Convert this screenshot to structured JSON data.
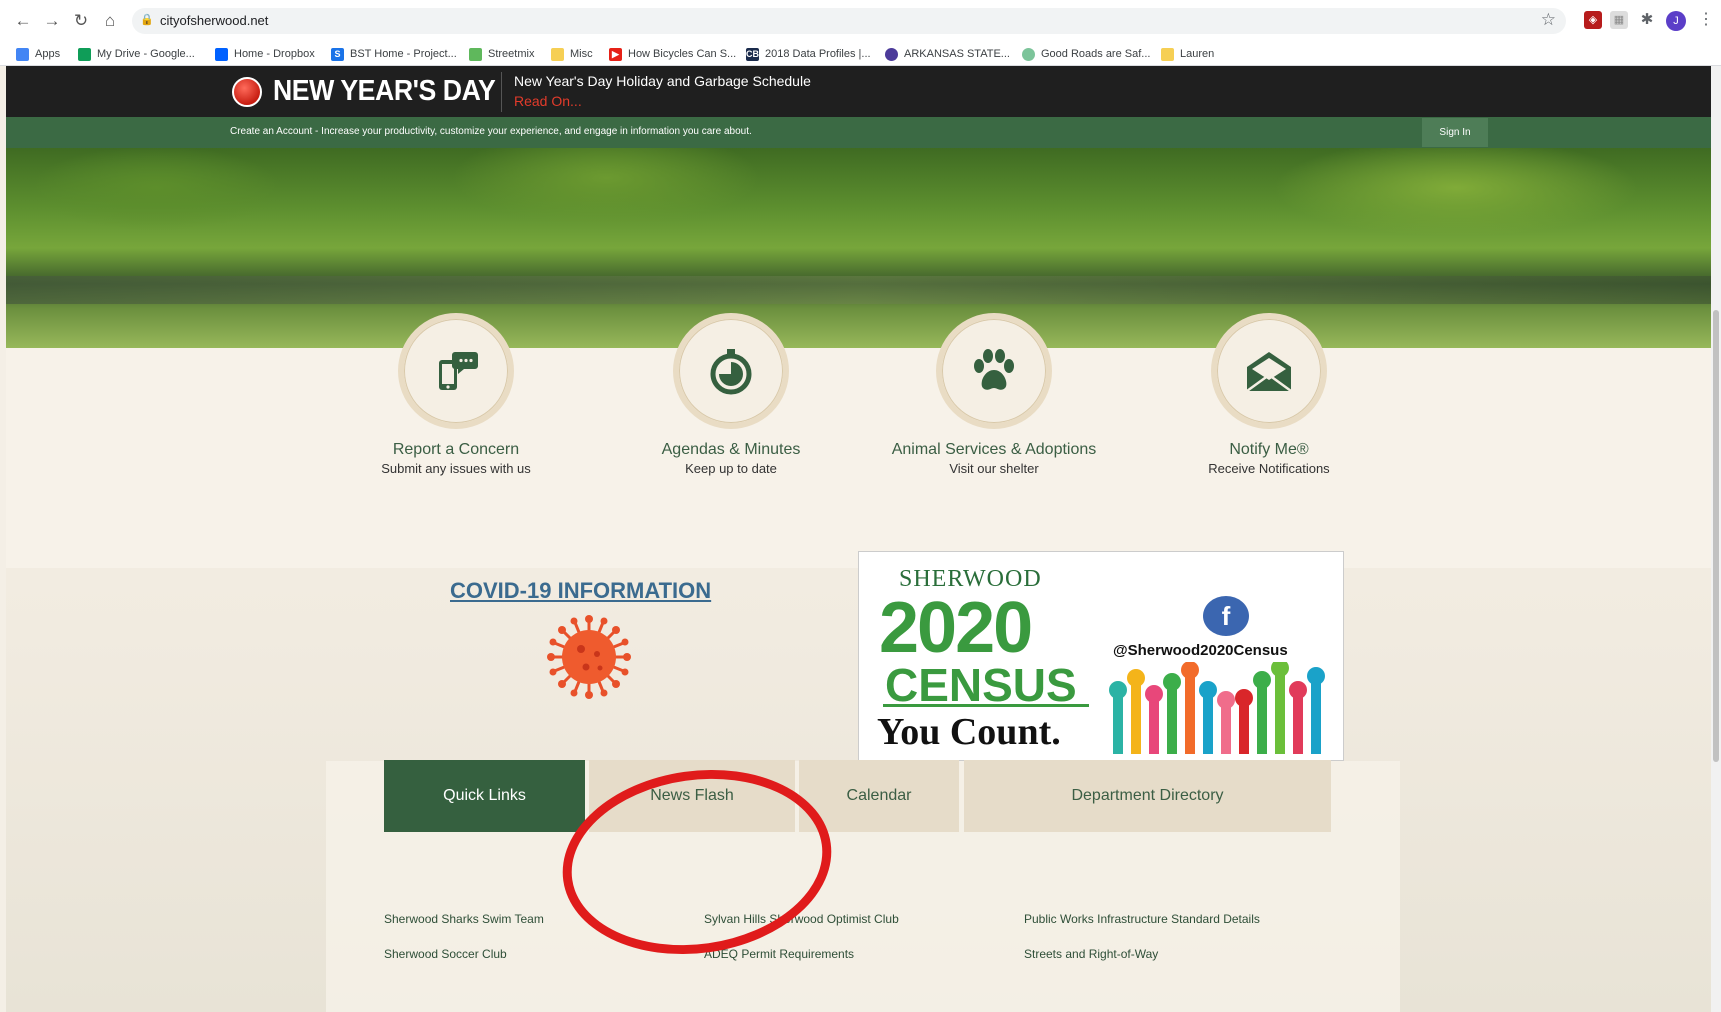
{
  "browser": {
    "url": "cityofsherwood.net",
    "profile_initial": "J",
    "bookmarks": [
      "Apps",
      "My Drive - Google...",
      "Home - Dropbox",
      "BST Home - Project...",
      "Streetmix",
      "Misc",
      "How Bicycles Can S...",
      "2018 Data Profiles |...",
      "ARKANSAS STATE...",
      "Good Roads are Saf...",
      "Lauren"
    ]
  },
  "alert": {
    "title": "NEW YEAR'S DAY",
    "headline": "New Year's Day Holiday and Garbage Schedule",
    "link": "Read On..."
  },
  "account": {
    "text": "Create an Account - Increase your productivity, customize your experience, and engage in information you care about.",
    "signin": "Sign In"
  },
  "services": [
    {
      "title": "Report a Concern",
      "sub": "Submit any issues with us",
      "icon": "phone-chat-icon"
    },
    {
      "title": "Agendas & Minutes",
      "sub": "Keep up to date",
      "icon": "stopwatch-icon"
    },
    {
      "title": "Animal Services & Adoptions",
      "sub": "Visit our shelter",
      "icon": "paw-icon"
    },
    {
      "title": "Notify Me®",
      "sub": "Receive Notifications",
      "icon": "envelope-icon"
    }
  ],
  "covid": {
    "link": "COVID-19 INFORMATION"
  },
  "census": {
    "sherwood": "SHERWOOD",
    "year": "2020",
    "census": "CENSUS",
    "tagline": "You Count.",
    "handle": "@Sherwood2020Census"
  },
  "tabs": [
    "Quick Links",
    "News Flash",
    "Calendar",
    "Department Directory"
  ],
  "quick_links": {
    "col1": [
      "Sherwood Sharks Swim Team",
      "Sherwood Soccer Club"
    ],
    "col2": [
      "Sylvan Hills Sherwood Optimist Club",
      "ADEQ Permit Requirements"
    ],
    "col3": [
      "Public Works Infrastructure Standard Details",
      "Streets and Right-of-Way"
    ]
  },
  "colors": {
    "accent_green": "#35603f",
    "tab_tan": "#e6dcc9",
    "alert_red": "#e23b2b",
    "annotation": "#e01b1b"
  }
}
